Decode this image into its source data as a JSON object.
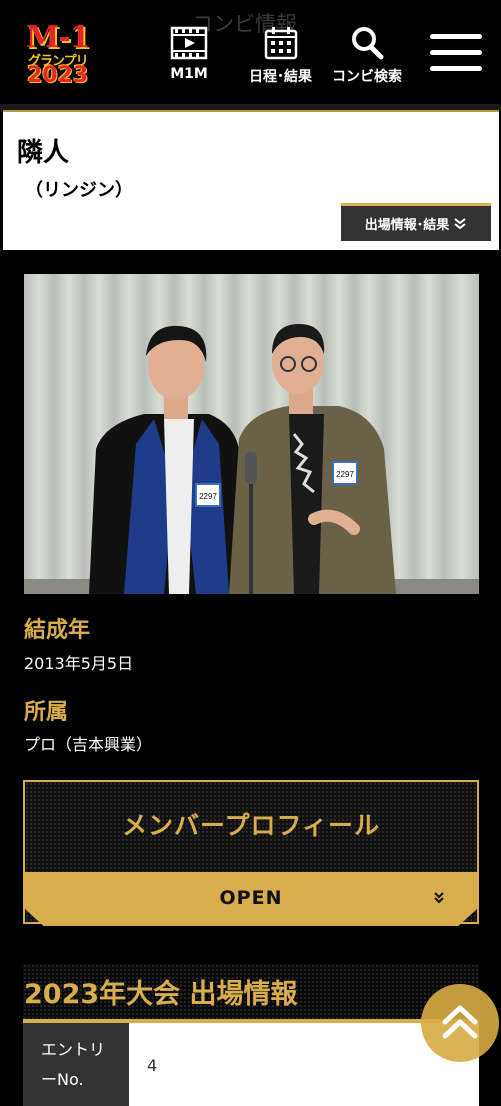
{
  "header": {
    "ghost_title": "コンビ情報",
    "logo": {
      "line1": "M-1",
      "line2": "グランプリ",
      "line3": "2023"
    },
    "nav": [
      {
        "label": "M1M",
        "icon": "video-icon"
      },
      {
        "label": "日程･結果",
        "icon": "calendar-icon"
      },
      {
        "label": "コンビ検索",
        "icon": "search-icon"
      }
    ],
    "menu_icon": "hamburger-menu-icon"
  },
  "combi": {
    "name": "隣人",
    "reading": "（リンジン）",
    "result_button": "出場情報･結果"
  },
  "info": {
    "formed_label": "結成年",
    "formed_value": "2013年5月5日",
    "agency_label": "所属",
    "agency_value": "プロ（吉本興業）"
  },
  "profile": {
    "title": "メンバープロフィール",
    "open_label": "OPEN"
  },
  "entry_section": {
    "title": "2023年大会 出場情報",
    "rows": [
      {
        "header_line1": "エントリ",
        "header_line2": "ーNo.",
        "value": "4"
      }
    ]
  },
  "photo": {
    "entry_tag_left": "2297",
    "entry_tag_right": "2297"
  },
  "colors": {
    "gold": "#d9ad4b",
    "background": "#000000",
    "button_dark": "#333333",
    "logo_red": "#e8242b"
  }
}
